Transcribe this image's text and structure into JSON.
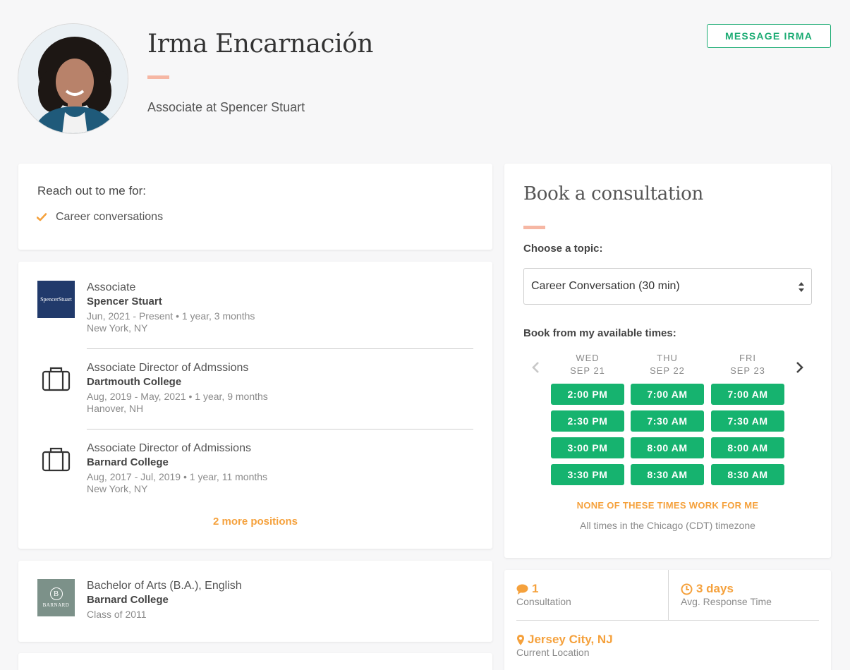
{
  "profile": {
    "name": "Irma Encarnación",
    "headline": "Associate at Spencer Stuart",
    "message_button": "MESSAGE IRMA"
  },
  "reach_out": {
    "title": "Reach out to me for:",
    "items": [
      "Career conversations"
    ]
  },
  "experience": {
    "positions": [
      {
        "title": "Associate",
        "org": "Spencer Stuart",
        "dates": "Jun, 2021 - Present • 1 year, 3 months",
        "location": "New York, NY",
        "logo_text": "SpencerStuart"
      },
      {
        "title": "Associate Director of Admssions",
        "org": "Dartmouth College",
        "dates": "Aug, 2019 - May, 2021 • 1 year, 9 months",
        "location": "Hanover, NH"
      },
      {
        "title": "Associate Director of Admissions",
        "org": "Barnard College",
        "dates": "Aug, 2017 - Jul, 2019 • 1 year, 11 months",
        "location": "New York, NY"
      }
    ],
    "more_link": "2 more positions"
  },
  "education": {
    "degree": "Bachelor of Arts (B.A.), English",
    "school": "Barnard College",
    "class_of": "Class of 2011",
    "logo_letter": "B",
    "logo_text": "BARNARD"
  },
  "booking": {
    "title": "Book a consultation",
    "topic_label": "Choose a topic:",
    "topic_value": "Career Conversation (30 min)",
    "times_label": "Book from my available times:",
    "days": [
      {
        "day": "WED",
        "date": "SEP 21",
        "slots": [
          "2:00 PM",
          "2:30 PM",
          "3:00 PM",
          "3:30 PM"
        ]
      },
      {
        "day": "THU",
        "date": "SEP 22",
        "slots": [
          "7:00 AM",
          "7:30 AM",
          "8:00 AM",
          "8:30 AM"
        ]
      },
      {
        "day": "FRI",
        "date": "SEP 23",
        "slots": [
          "7:00 AM",
          "7:30 AM",
          "8:00 AM",
          "8:30 AM"
        ]
      }
    ],
    "none_work": "NONE OF THESE TIMES WORK FOR ME",
    "timezone_note": "All times in the Chicago (CDT) timezone"
  },
  "stats": {
    "consultations_value": "1",
    "consultations_label": "Consultation",
    "response_value": "3 days",
    "response_label": "Avg. Response Time",
    "location_value": "Jersey City, NJ",
    "location_label": "Current Location"
  },
  "colors": {
    "accent_green": "#16b36f",
    "accent_orange": "#f5a13c",
    "accent_peach": "#f6b7a4",
    "spencer_navy": "#213a6b",
    "barnard_gray": "#7c9189"
  }
}
